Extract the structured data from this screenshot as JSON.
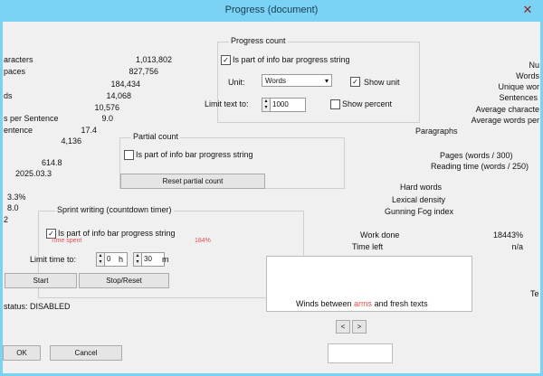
{
  "window": {
    "title": "Progress (document)",
    "close": "✕"
  },
  "left_stats": [
    {
      "label": "aracters",
      "value": "1,013,802"
    },
    {
      "label": "paces",
      "value": "827,756"
    },
    {
      "label": "",
      "value": "184,434"
    },
    {
      "label": "ds",
      "value": "14,068"
    },
    {
      "label": "",
      "value": "10,576"
    },
    {
      "label": "s per Sentence",
      "value": "9.0"
    },
    {
      "label": "entence",
      "value": "17.4"
    },
    {
      "label": "",
      "value": "4,136"
    }
  ],
  "left_misc": [
    "614.8",
    "2025.03.3",
    "3.3%",
    "8.0",
    "2"
  ],
  "progress_count": {
    "legend": "Progress count",
    "infobar_label": "Is part of info bar progress string",
    "unit_label": "Unit:",
    "unit_value": "Words",
    "show_unit": "Show unit",
    "limit_label": "Limit text to:",
    "limit_value": "1000",
    "show_percent": "Show percent"
  },
  "partial_count": {
    "legend": "Partial count",
    "infobar_label": "Is part of info bar progress string",
    "reset_button": "Reset partial count"
  },
  "sprint": {
    "legend": "Sprint writing (countdown timer)",
    "infobar_label": "Is part of info bar progress string",
    "limit_label": "Limit time to:",
    "hours_value": "0",
    "hours_unit": "h",
    "minutes_value": "30",
    "minutes_unit": "m",
    "start_button": "Start",
    "stop_button": "Stop/Reset",
    "status": "status: DISABLED",
    "red_left": "Time spent",
    "red_right": "184%"
  },
  "right_stats": [
    "Nu",
    "Words",
    "Unique wor",
    "Sentences",
    "Average characte",
    "Average words per",
    "Paragraphs"
  ],
  "right_lower": {
    "pages": "Pages (words / 300)",
    "reading_time": "Reading time (words / 250)",
    "hard_words": "Hard words",
    "lexical_density": "Lexical density",
    "gunning_fog": "Gunning Fog index",
    "work_done_label": "Work done",
    "work_done_value": "18443%",
    "time_left_label": "Time left",
    "time_left_value": "n/a",
    "trailing": "Te"
  },
  "preview": {
    "text_black": "Winds between ",
    "text_red": "arms ",
    "text_black2": "and fresh texts"
  },
  "pager": {
    "prev": "<",
    "next": ">"
  },
  "footer": {
    "ok": "OK",
    "cancel": "Cancel"
  }
}
